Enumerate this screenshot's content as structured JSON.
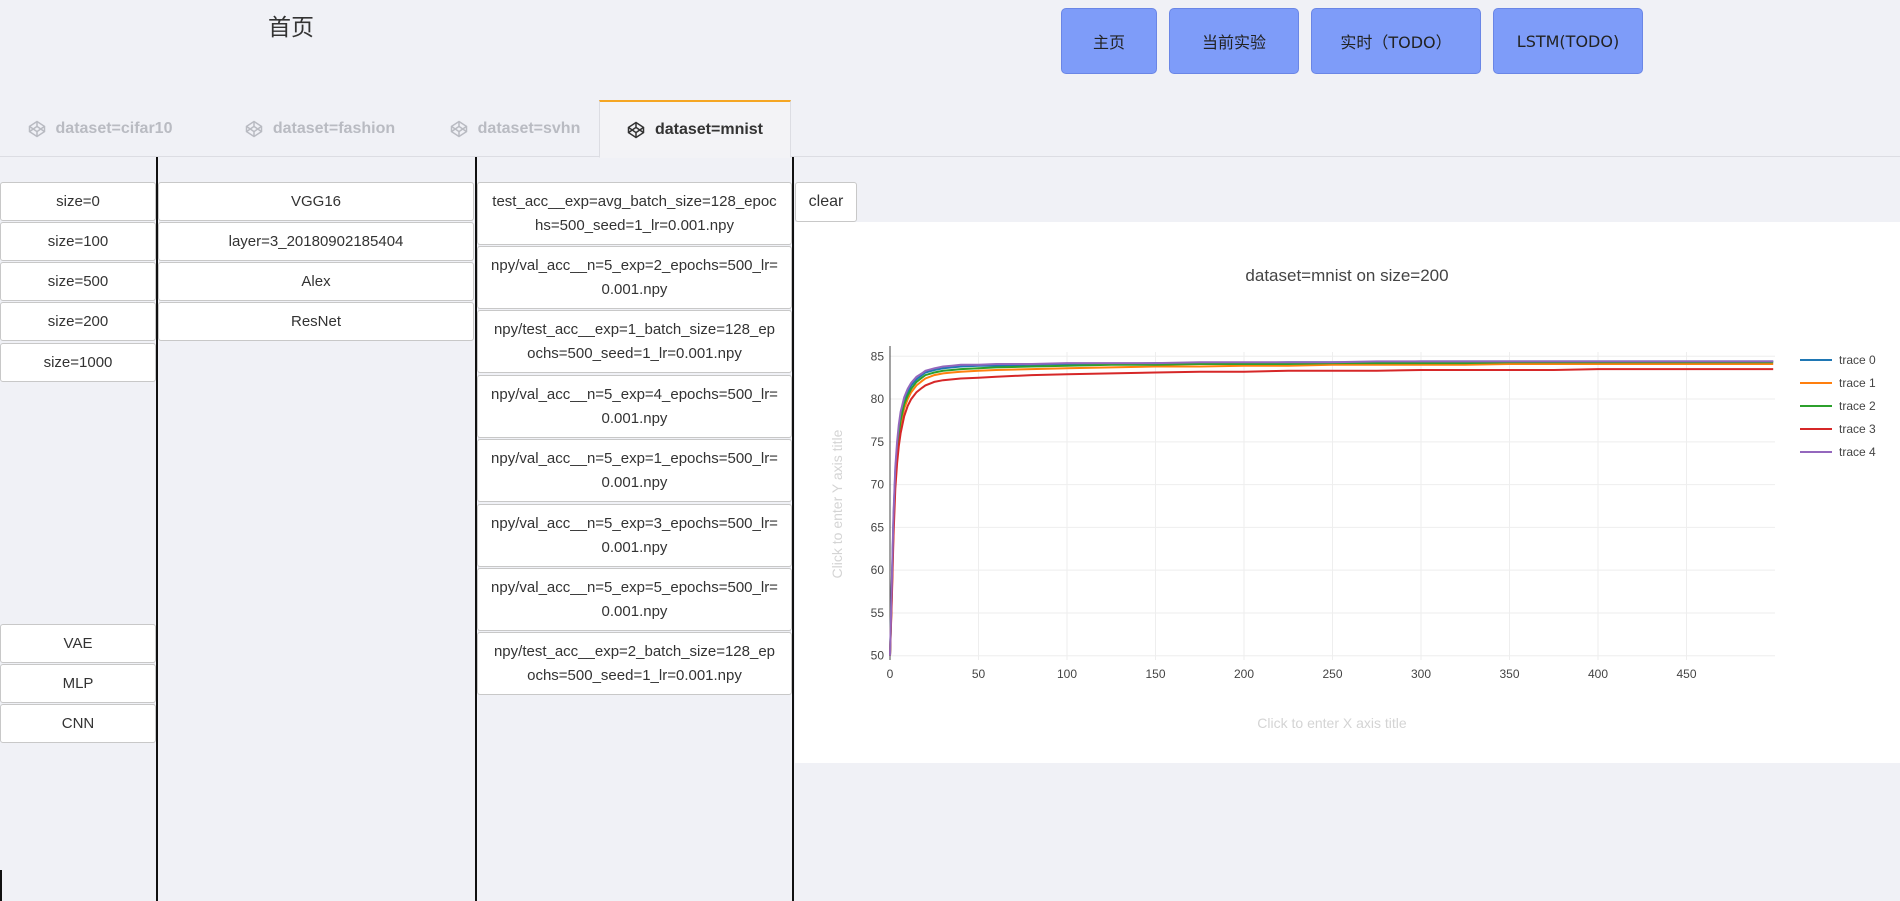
{
  "header": {
    "title": "首页"
  },
  "nav": [
    {
      "label": "主页"
    },
    {
      "label": "当前实验"
    },
    {
      "label": "实时（TODO）"
    },
    {
      "label": "LSTM(TODO)"
    }
  ],
  "tabs": [
    {
      "label": "dataset=cifar10",
      "active": false
    },
    {
      "label": "dataset=fashion",
      "active": false
    },
    {
      "label": "dataset=svhn",
      "active": false
    },
    {
      "label": "dataset=mnist",
      "active": true
    }
  ],
  "sizes": [
    "size=0",
    "size=100",
    "size=500",
    "size=200",
    "size=1000"
  ],
  "model_types": [
    "VAE",
    "MLP",
    "CNN"
  ],
  "models": [
    "VGG16",
    "layer=3_20180902185404",
    "Alex",
    "ResNet"
  ],
  "files": [
    "test_acc__exp=avg_batch_size=128_epochs=500_seed=1_lr=0.001.npy",
    "npy/val_acc__n=5_exp=2_epochs=500_lr=0.001.npy",
    "npy/test_acc__exp=1_batch_size=128_epochs=500_seed=1_lr=0.001.npy",
    "npy/val_acc__n=5_exp=4_epochs=500_lr=0.001.npy",
    "npy/val_acc__n=5_exp=1_epochs=500_lr=0.001.npy",
    "npy/val_acc__n=5_exp=3_epochs=500_lr=0.001.npy",
    "npy/val_acc__n=5_exp=5_epochs=500_lr=0.001.npy",
    "npy/test_acc__exp=2_batch_size=128_epochs=500_seed=1_lr=0.001.npy"
  ],
  "clear_label": "clear",
  "chart_data": {
    "type": "line",
    "title": "dataset=mnist on size=200",
    "xlabel": "Click to enter X axis title",
    "ylabel": "Click to enter Y axis title",
    "xlim": [
      0,
      500
    ],
    "ylim": [
      49.5,
      85.5
    ],
    "x_ticks": [
      0,
      50,
      100,
      150,
      200,
      250,
      300,
      350,
      400,
      450
    ],
    "y_ticks": [
      50,
      55,
      60,
      65,
      70,
      75,
      80,
      85
    ],
    "grid": true,
    "legend_position": "top-right",
    "x": [
      0,
      1,
      2,
      3,
      4,
      5,
      6,
      8,
      10,
      12,
      15,
      18,
      20,
      25,
      30,
      35,
      40,
      50,
      60,
      80,
      100,
      125,
      150,
      175,
      200,
      225,
      250,
      275,
      300,
      325,
      350,
      375,
      400,
      425,
      450,
      475,
      499
    ],
    "series": [
      {
        "name": "trace 0",
        "color": "#1f77b4",
        "values": [
          50.0,
          58.0,
          66.0,
          71.5,
          74.5,
          76.5,
          78.0,
          79.8,
          80.8,
          81.6,
          82.3,
          82.8,
          83.1,
          83.4,
          83.6,
          83.7,
          83.8,
          83.9,
          83.9,
          84.0,
          84.1,
          84.1,
          84.2,
          84.2,
          84.2,
          84.3,
          84.3,
          84.3,
          84.4,
          84.4,
          84.4,
          84.4,
          84.4,
          84.4,
          84.4,
          84.4,
          84.4
        ]
      },
      {
        "name": "trace 1",
        "color": "#ff7f0e",
        "values": [
          50.0,
          57.0,
          65.0,
          70.5,
          73.5,
          75.5,
          77.0,
          78.9,
          80.0,
          80.8,
          81.6,
          82.1,
          82.4,
          82.8,
          83.0,
          83.1,
          83.2,
          83.3,
          83.4,
          83.5,
          83.6,
          83.7,
          83.8,
          83.8,
          83.9,
          83.9,
          84.0,
          84.0,
          84.0,
          84.0,
          84.1,
          84.1,
          84.1,
          84.1,
          84.1,
          84.1,
          84.1
        ]
      },
      {
        "name": "trace 2",
        "color": "#2ca02c",
        "values": [
          50.0,
          57.5,
          65.5,
          71.0,
          74.0,
          76.0,
          77.5,
          79.4,
          80.4,
          81.2,
          82.0,
          82.5,
          82.8,
          83.1,
          83.3,
          83.4,
          83.5,
          83.6,
          83.7,
          83.8,
          83.9,
          84.0,
          84.0,
          84.1,
          84.1,
          84.1,
          84.2,
          84.2,
          84.2,
          84.2,
          84.3,
          84.3,
          84.3,
          84.3,
          84.3,
          84.3,
          84.3
        ]
      },
      {
        "name": "trace 3",
        "color": "#d62728",
        "values": [
          50.0,
          56.5,
          64.0,
          69.5,
          72.5,
          74.5,
          76.0,
          78.0,
          79.2,
          80.0,
          80.8,
          81.3,
          81.6,
          82.0,
          82.2,
          82.3,
          82.4,
          82.5,
          82.6,
          82.8,
          82.9,
          83.0,
          83.1,
          83.2,
          83.2,
          83.3,
          83.3,
          83.3,
          83.4,
          83.4,
          83.4,
          83.4,
          83.5,
          83.5,
          83.5,
          83.5,
          83.5
        ]
      },
      {
        "name": "trace 4",
        "color": "#9467bd",
        "values": [
          50.0,
          58.5,
          66.5,
          72.0,
          75.0,
          77.0,
          78.5,
          80.2,
          81.2,
          81.9,
          82.6,
          83.0,
          83.3,
          83.6,
          83.8,
          83.9,
          84.0,
          84.0,
          84.1,
          84.1,
          84.2,
          84.2,
          84.2,
          84.3,
          84.3,
          84.3,
          84.3,
          84.4,
          84.4,
          84.4,
          84.4,
          84.4,
          84.4,
          84.4,
          84.4,
          84.4,
          84.4
        ]
      }
    ]
  }
}
